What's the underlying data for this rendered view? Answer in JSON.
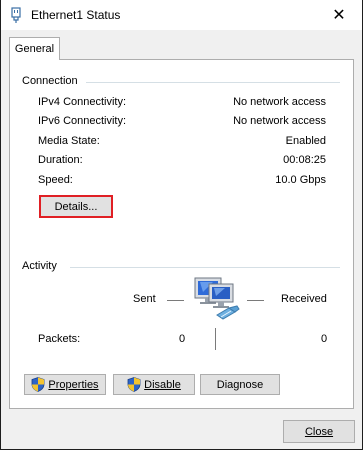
{
  "window": {
    "title": "Ethernet1 Status",
    "close_glyph": "✕"
  },
  "tabs": [
    {
      "label": "General"
    }
  ],
  "connection": {
    "group_label": "Connection",
    "rows": [
      {
        "label": "IPv4 Connectivity:",
        "value": "No network access"
      },
      {
        "label": "IPv6 Connectivity:",
        "value": "No network access"
      },
      {
        "label": "Media State:",
        "value": "Enabled"
      },
      {
        "label": "Duration:",
        "value": "00:08:25"
      },
      {
        "label": "Speed:",
        "value": "10.0 Gbps"
      }
    ],
    "details_button": "Details..."
  },
  "activity": {
    "group_label": "Activity",
    "sent_label": "Sent",
    "received_label": "Received",
    "packets_label": "Packets:",
    "packets_sent": "0",
    "packets_received": "0"
  },
  "buttons": {
    "properties": "Properties",
    "disable": "Disable",
    "diagnose": "Diagnose",
    "close": "Close"
  },
  "icons": {
    "title": "ethernet-plug-icon",
    "network": "network-computer-icon",
    "shield": "uac-shield-icon"
  },
  "colors": {
    "focus_border": "#e01f24",
    "button_face": "#e1e1e1",
    "panel_bg": "#ffffff",
    "window_bg": "#f0f0f0"
  }
}
